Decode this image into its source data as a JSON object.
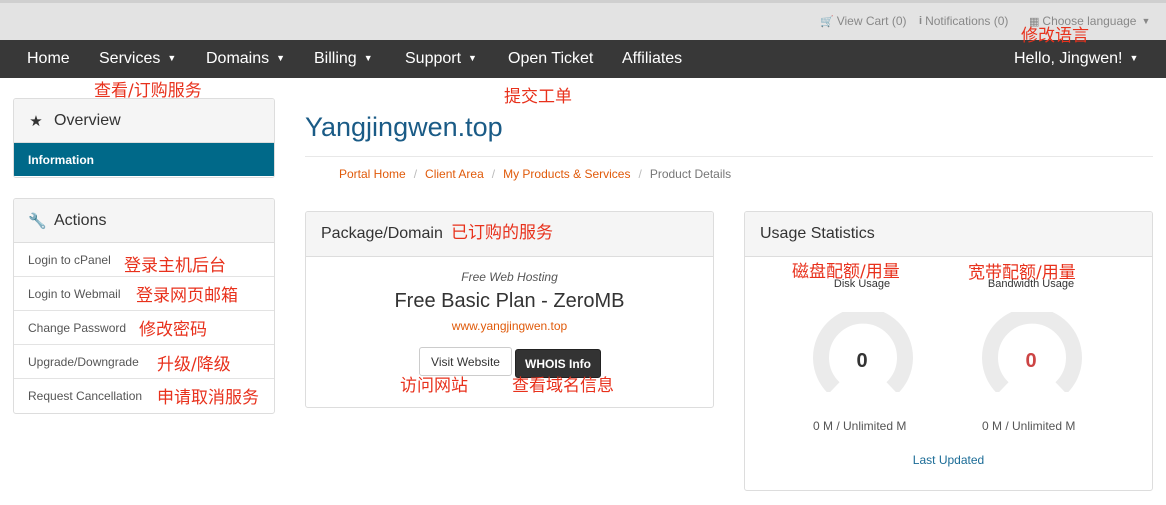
{
  "topbar": {
    "view_cart": "View Cart (0)",
    "notifications": "Notifications (0)",
    "language": "Choose language"
  },
  "nav": {
    "home": "Home",
    "services": "Services",
    "domains": "Domains",
    "billing": "Billing",
    "support": "Support",
    "open_ticket": "Open Ticket",
    "affiliates": "Affiliates",
    "user": "Hello, Jingwen!"
  },
  "annotations": {
    "language": "修改语言",
    "services": "查看/订购服务",
    "open_ticket": "提交工单",
    "package": "已订购的服务",
    "cpanel": "登录主机后台",
    "webmail": "登录网页邮箱",
    "password": "修改密码",
    "upgrade": "升级/降级",
    "cancel": "申请取消服务",
    "visit": "访问网站",
    "whois": "查看域名信息",
    "disk": "磁盘配额/用量",
    "bandwidth": "宽带配额/用量"
  },
  "sidebar": {
    "overview_title": "Overview",
    "information": "Information",
    "actions_title": "Actions",
    "actions": [
      "Login to cPanel",
      "Login to Webmail",
      "Change Password",
      "Upgrade/Downgrade",
      "Request Cancellation"
    ]
  },
  "page": {
    "title": "Yangjingwen.top"
  },
  "breadcrumb": {
    "items": [
      "Portal Home",
      "Client Area",
      "My Products & Services"
    ],
    "current": "Product Details"
  },
  "package": {
    "header": "Package/Domain",
    "group": "Free Web Hosting",
    "plan": "Free Basic Plan - ZeroMB",
    "domain": "www.yangjingwen.top",
    "visit_label": "Visit Website",
    "whois_label": "WHOIS Info"
  },
  "usage": {
    "header": "Usage Statistics",
    "disk_label": "Disk Usage",
    "disk_value": "0",
    "disk_value_fraction": 0,
    "disk_detail": "0 M / Unlimited M",
    "bw_label": "Bandwidth Usage",
    "bw_value": "0",
    "bw_value_fraction": 0,
    "bw_detail": "0 M / Unlimited M",
    "last_updated": "Last Updated"
  },
  "colors": {
    "nav_bg": "#383838",
    "accent": "#006989",
    "link": "#e05a0a",
    "title": "#1a5b86",
    "annotation": "#e8311c",
    "bw_value": "#cc4444"
  },
  "icons": {
    "cart": "cart-icon",
    "notifications": "info-icon",
    "language": "language-icon",
    "overview": "star-icon",
    "actions": "wrench-icon"
  }
}
